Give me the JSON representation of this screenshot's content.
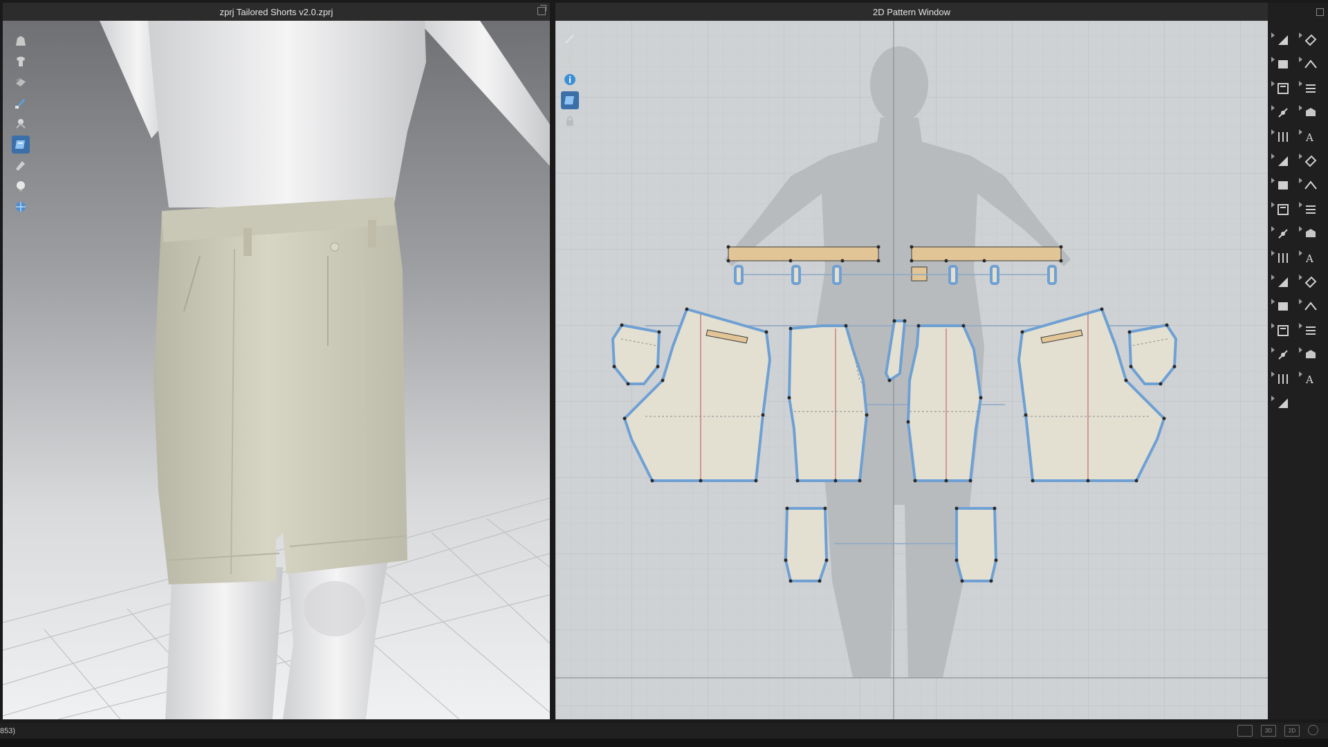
{
  "window3d": {
    "title": "zprj Tailored Shorts v2.0.zprj",
    "tools": [
      "avatar-icon",
      "garment-icon",
      "fabric-icon",
      "brush-icon",
      "pin-icon",
      "texture-icon",
      "edit-icon",
      "light-icon",
      "environment-icon"
    ],
    "active_tool_index": 5
  },
  "window2d": {
    "title": "2D Pattern Window",
    "tools": [
      "pen-icon",
      "garment-icon",
      "info-icon",
      "texture-icon",
      "lock-icon"
    ],
    "active_tool_index": 3
  },
  "rightbar": {
    "tools": [
      "transform-pattern-icon",
      "seam-icon",
      "edit-curve-icon",
      "sewing-icon",
      "polygon-icon",
      "segment-sewing-icon",
      "rectangle-icon",
      "free-sewing-icon",
      "internal-shape-icon",
      "tuck-icon",
      "dart-icon",
      "fold-icon",
      "notch-icon",
      "button-icon",
      "cut-icon",
      "buttonhole-icon",
      "trim-icon",
      "topstitch-icon",
      "fill-icon",
      "measure-icon",
      "elastic-icon",
      "ruler-icon",
      "annotation-icon",
      "grain-icon",
      "text-icon",
      "zigzag-icon",
      "grid-icon",
      "camera-icon",
      "avatar-3d-icon",
      "stack-icon",
      "pin-2d-icon"
    ]
  },
  "statusbar": {
    "text": "853)",
    "views": [
      "",
      "3D",
      "2D",
      ""
    ]
  },
  "colors": {
    "panel": "#2c2c2d",
    "grid_bg": "#cfd2d4",
    "pattern_fill": "#e3e0d2",
    "pattern_outline": "#6ea0d4",
    "waistband": "#e2c597",
    "avatar_shadow": "#b8bbbd",
    "shorts": "#cfcdbc",
    "accent": "#3a6fa8"
  }
}
